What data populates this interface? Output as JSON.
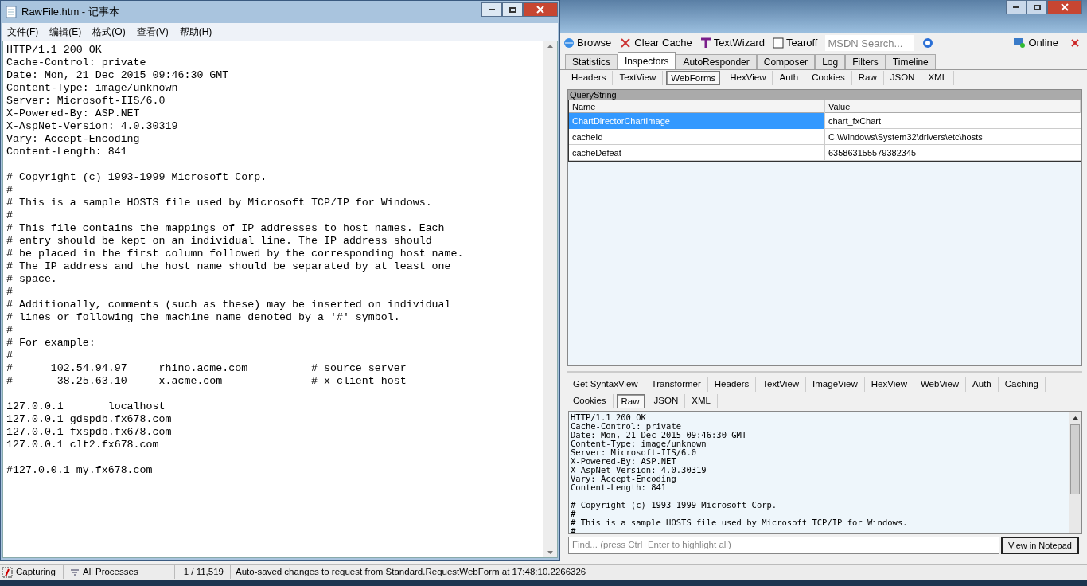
{
  "notepad": {
    "title": "RawFile.htm - 记事本",
    "menu": [
      "文件(F)",
      "编辑(E)",
      "格式(O)",
      "查看(V)",
      "帮助(H)"
    ],
    "blocks": [
      [
        "HTTP/1.1 200 OK",
        "Cache-Control: private",
        "Date: Mon, 21 Dec 2015 09:46:30 GMT",
        "Content-Type: image/unknown",
        "Server: Microsoft-IIS/6.0",
        "X-Powered-By: ASP.NET",
        "X-AspNet-Version: 4.0.30319",
        "Vary: Accept-Encoding",
        "Content-Length: 841"
      ],
      [
        "# Copyright (c) 1993-1999 Microsoft Corp.",
        "#",
        "# This is a sample HOSTS file used by Microsoft TCP/IP for Windows.",
        "#",
        "# This file contains the mappings of IP addresses to host names. Each",
        "# entry should be kept on an individual line. The IP address should",
        "# be placed in the first column followed by the corresponding host name.",
        "# The IP address and the host name should be separated by at least one",
        "# space.",
        "#",
        "# Additionally, comments (such as these) may be inserted on individual",
        "# lines or following the machine name denoted by a '#' symbol.",
        "#",
        "# For example:",
        "#",
        "#      102.54.94.97     rhino.acme.com          # source server",
        "#       38.25.63.10     x.acme.com              # x client host"
      ],
      [
        "127.0.0.1       localhost",
        "127.0.0.1 gdspdb.fx678.com",
        "127.0.0.1 fxspdb.fx678.com",
        "127.0.0.1 clt2.fx678.com"
      ],
      [
        "#127.0.0.1 my.fx678.com"
      ]
    ]
  },
  "fiddler": {
    "toolbar": [
      {
        "kind": "browse",
        "label": "Browse"
      },
      {
        "kind": "clear",
        "label": "Clear Cache"
      },
      {
        "kind": "wizard",
        "label": "TextWizard"
      },
      {
        "kind": "tearoff",
        "label": "Tearoff"
      }
    ],
    "search": {
      "placeholder": "MSDN Search..."
    },
    "online": "Online",
    "tabs": [
      {
        "label": "Statistics",
        "selected": false
      },
      {
        "label": "Inspectors",
        "selected": true
      },
      {
        "label": "AutoResponder",
        "selected": false
      },
      {
        "label": "Composer",
        "selected": false
      },
      {
        "label": "Log",
        "selected": false
      },
      {
        "label": "Filters",
        "selected": false
      },
      {
        "label": "Timeline",
        "selected": false
      }
    ],
    "request_tabs": [
      {
        "label": "Headers",
        "selected": false
      },
      {
        "label": "TextView",
        "selected": false
      },
      {
        "label": "WebForms",
        "selected": true
      },
      {
        "label": "HexView",
        "selected": false
      },
      {
        "label": "Auth",
        "selected": false
      },
      {
        "label": "Cookies",
        "selected": false
      },
      {
        "label": "Raw",
        "selected": false
      },
      {
        "label": "JSON",
        "selected": false
      },
      {
        "label": "XML",
        "selected": false
      }
    ],
    "querystring": {
      "title": "QueryString",
      "columns": [
        "Name",
        "Value"
      ],
      "rows": [
        {
          "name": "ChartDirectorChartImage",
          "value": "chart_fxChart",
          "selected": true
        },
        {
          "name": "cacheId",
          "value": "C:\\Windows\\System32\\drivers\\etc\\hosts",
          "selected": false
        },
        {
          "name": "cacheDefeat",
          "value": "635863155579382345",
          "selected": false
        }
      ]
    },
    "response_tabs": [
      [
        {
          "label": "Get SyntaxView",
          "selected": false
        },
        {
          "label": "Transformer",
          "selected": false
        },
        {
          "label": "Headers",
          "selected": false
        },
        {
          "label": "TextView",
          "selected": false
        },
        {
          "label": "ImageView",
          "selected": false
        },
        {
          "label": "HexView",
          "selected": false
        },
        {
          "label": "WebView",
          "selected": false
        },
        {
          "label": "Auth",
          "selected": false
        },
        {
          "label": "Caching",
          "selected": false
        }
      ],
      [
        {
          "label": "Cookies",
          "selected": false
        },
        {
          "label": "Raw",
          "selected": true
        },
        {
          "label": "JSON",
          "selected": false
        },
        {
          "label": "XML",
          "selected": false
        }
      ]
    ],
    "raw_blocks": [
      [
        "HTTP/1.1 200 OK",
        "Cache-Control: private",
        "Date: Mon, 21 Dec 2015 09:46:30 GMT",
        "Content-Type: image/unknown",
        "Server: Microsoft-IIS/6.0",
        "X-Powered-By: ASP.NET",
        "X-AspNet-Version: 4.0.30319",
        "Vary: Accept-Encoding",
        "Content-Length: 841"
      ],
      [
        "# Copyright (c) 1993-1999 Microsoft Corp.",
        "#",
        "# This is a sample HOSTS file used by Microsoft TCP/IP for Windows.",
        "#"
      ]
    ],
    "find": {
      "placeholder": "Find... (press Ctrl+Enter to highlight all)"
    },
    "view_button": "View in Notepad",
    "status": {
      "capturing": "Capturing",
      "processes": "All Processes",
      "count": "1 / 11,519",
      "message": "Auto-saved changes to request from Standard.RequestWebForm at 17:48:10.2266326"
    }
  }
}
